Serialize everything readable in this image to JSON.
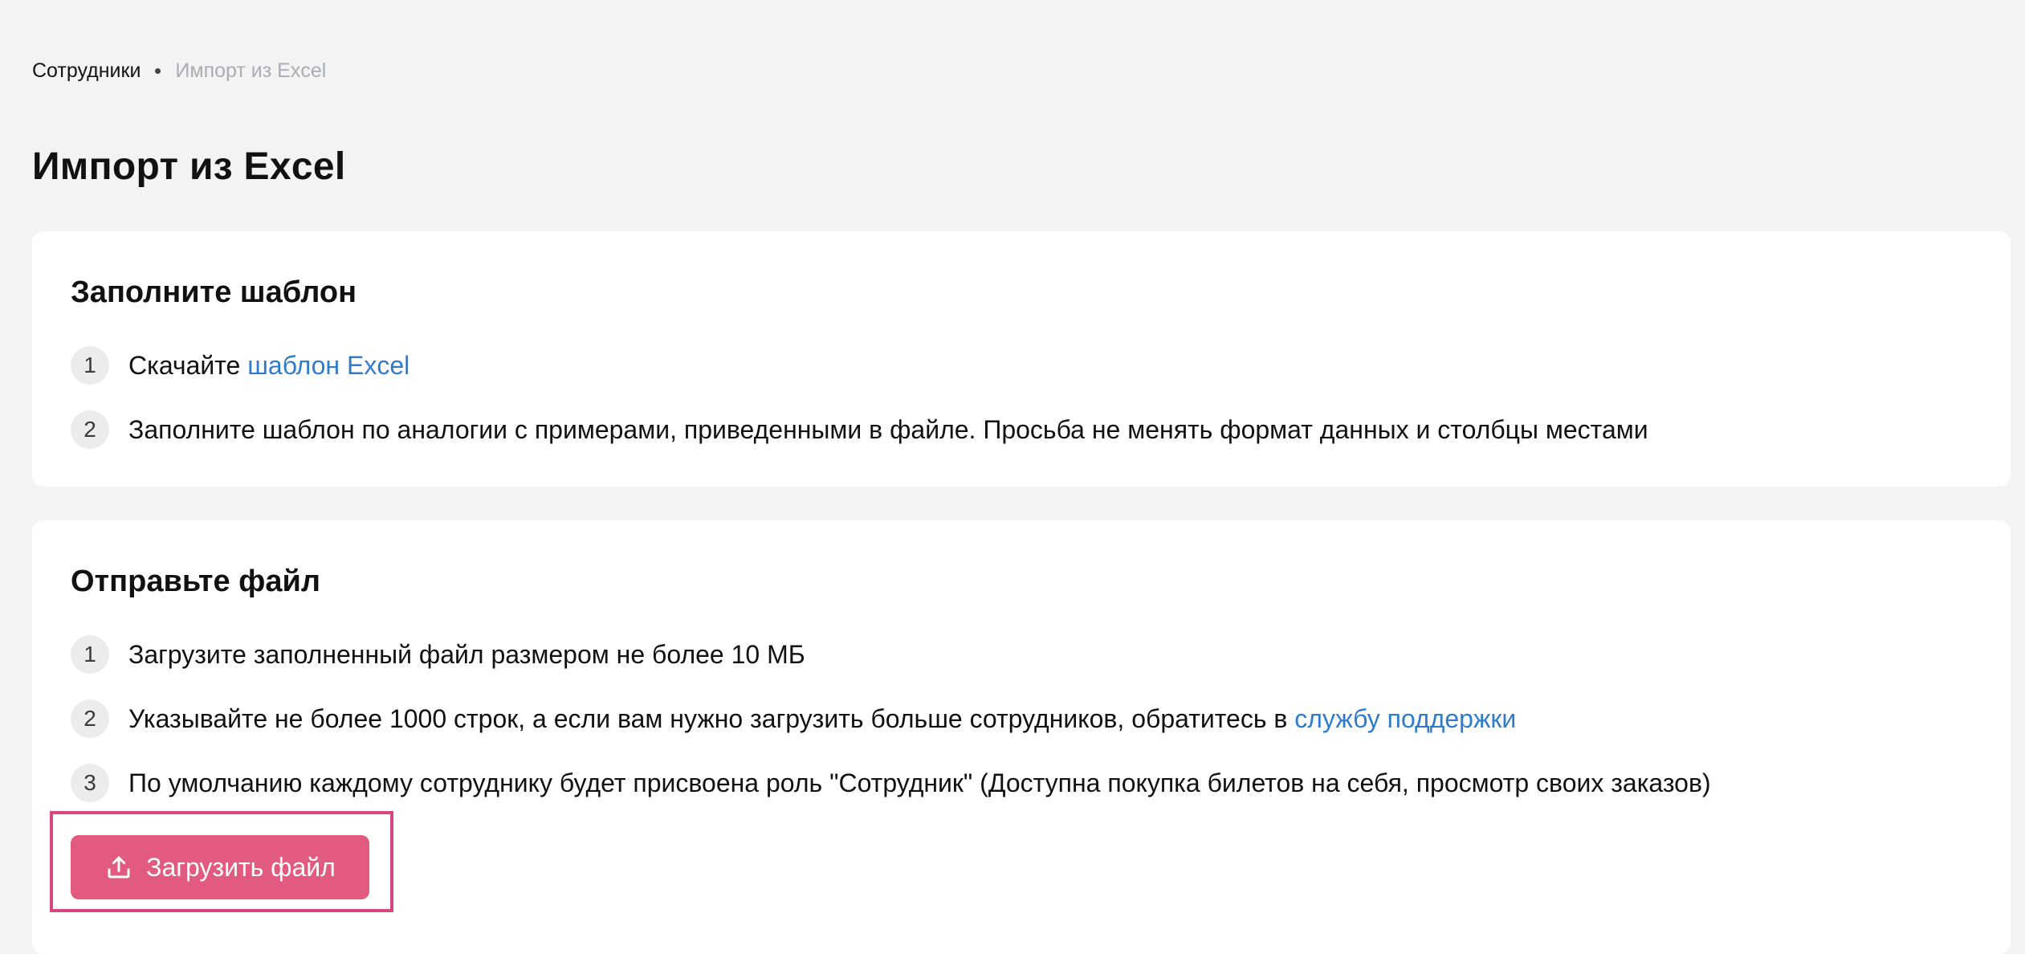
{
  "breadcrumb": {
    "parent": "Сотрудники",
    "current": "Импорт из Excel"
  },
  "page": {
    "title": "Импорт из Excel"
  },
  "fill_template": {
    "title": "Заполните шаблон",
    "steps": [
      {
        "number": "1",
        "text": "Скачайте ",
        "link": "шаблон Excel"
      },
      {
        "number": "2",
        "text": "Заполните шаблон по аналогии с примерами, приведенными в файле. Просьба не менять формат данных и столбцы местами"
      }
    ]
  },
  "send_file": {
    "title": "Отправьте файл",
    "steps": [
      {
        "number": "1",
        "text": "Загрузите заполненный файл размером не более 10 МБ"
      },
      {
        "number": "2",
        "text": "Указывайте не более 1000 строк, а если вам нужно загрузить больше сотрудников, обратитесь в ",
        "link": "службу поддержки"
      },
      {
        "number": "3",
        "text": "По умолчанию каждому сотруднику будет присвоена роль \"Сотрудник\" (Доступна покупка билетов на себя, просмотр своих заказов)"
      }
    ],
    "upload_button": {
      "label": "Загрузить файл",
      "icon": "upload-icon"
    }
  },
  "colors": {
    "background": "#f3f3f3",
    "card": "#ffffff",
    "link": "#2f7ccc",
    "accent_button": "#e35a80",
    "highlight_border": "#d9457f",
    "muted_text": "#a9adb5"
  }
}
